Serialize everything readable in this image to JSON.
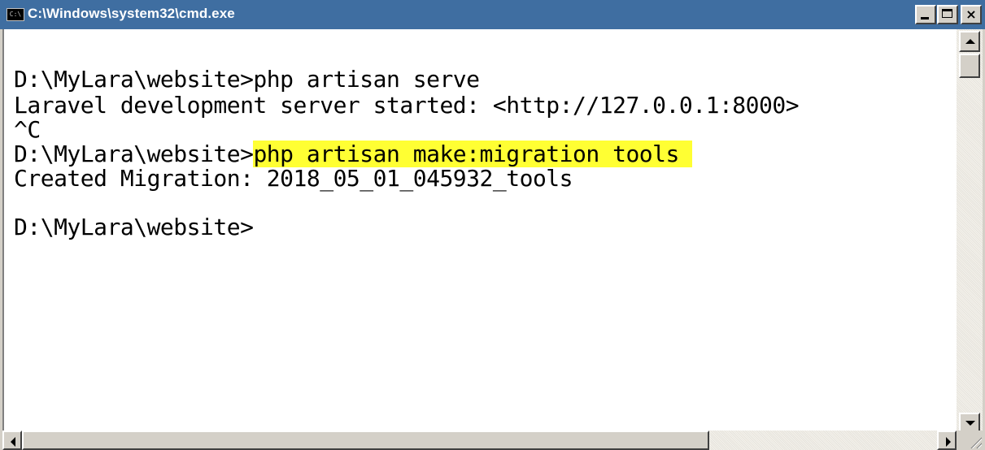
{
  "window": {
    "title": "C:\\Windows\\system32\\cmd.exe",
    "icon": "console-app-icon",
    "icon_text": "C:\\",
    "buttons": {
      "minimize_icon": "minimize-icon",
      "maximize_icon": "maximize-icon",
      "close_icon": "close-icon",
      "close_glyph": "×"
    }
  },
  "console": {
    "lines": [
      {
        "text": "D:\\MyLara\\website>php artisan serve"
      },
      {
        "text": "Laravel development server started: <http://127.0.0.1:8000>"
      },
      {
        "text": "^C"
      },
      {
        "prefix": "D:\\MyLara\\website>",
        "highlighted": "php artisan make:migration tools "
      },
      {
        "text": "Created Migration: 2018_05_01_045932_tools"
      },
      {
        "text": ""
      },
      {
        "text": "D:\\MyLara\\website>"
      }
    ],
    "highlight_color": "#ffff33"
  },
  "scrollbars": {
    "vertical": {
      "up_icon": "arrow-up-icon",
      "down_icon": "arrow-down-icon"
    },
    "horizontal": {
      "left_icon": "arrow-left-icon",
      "right_icon": "arrow-right-icon"
    }
  }
}
